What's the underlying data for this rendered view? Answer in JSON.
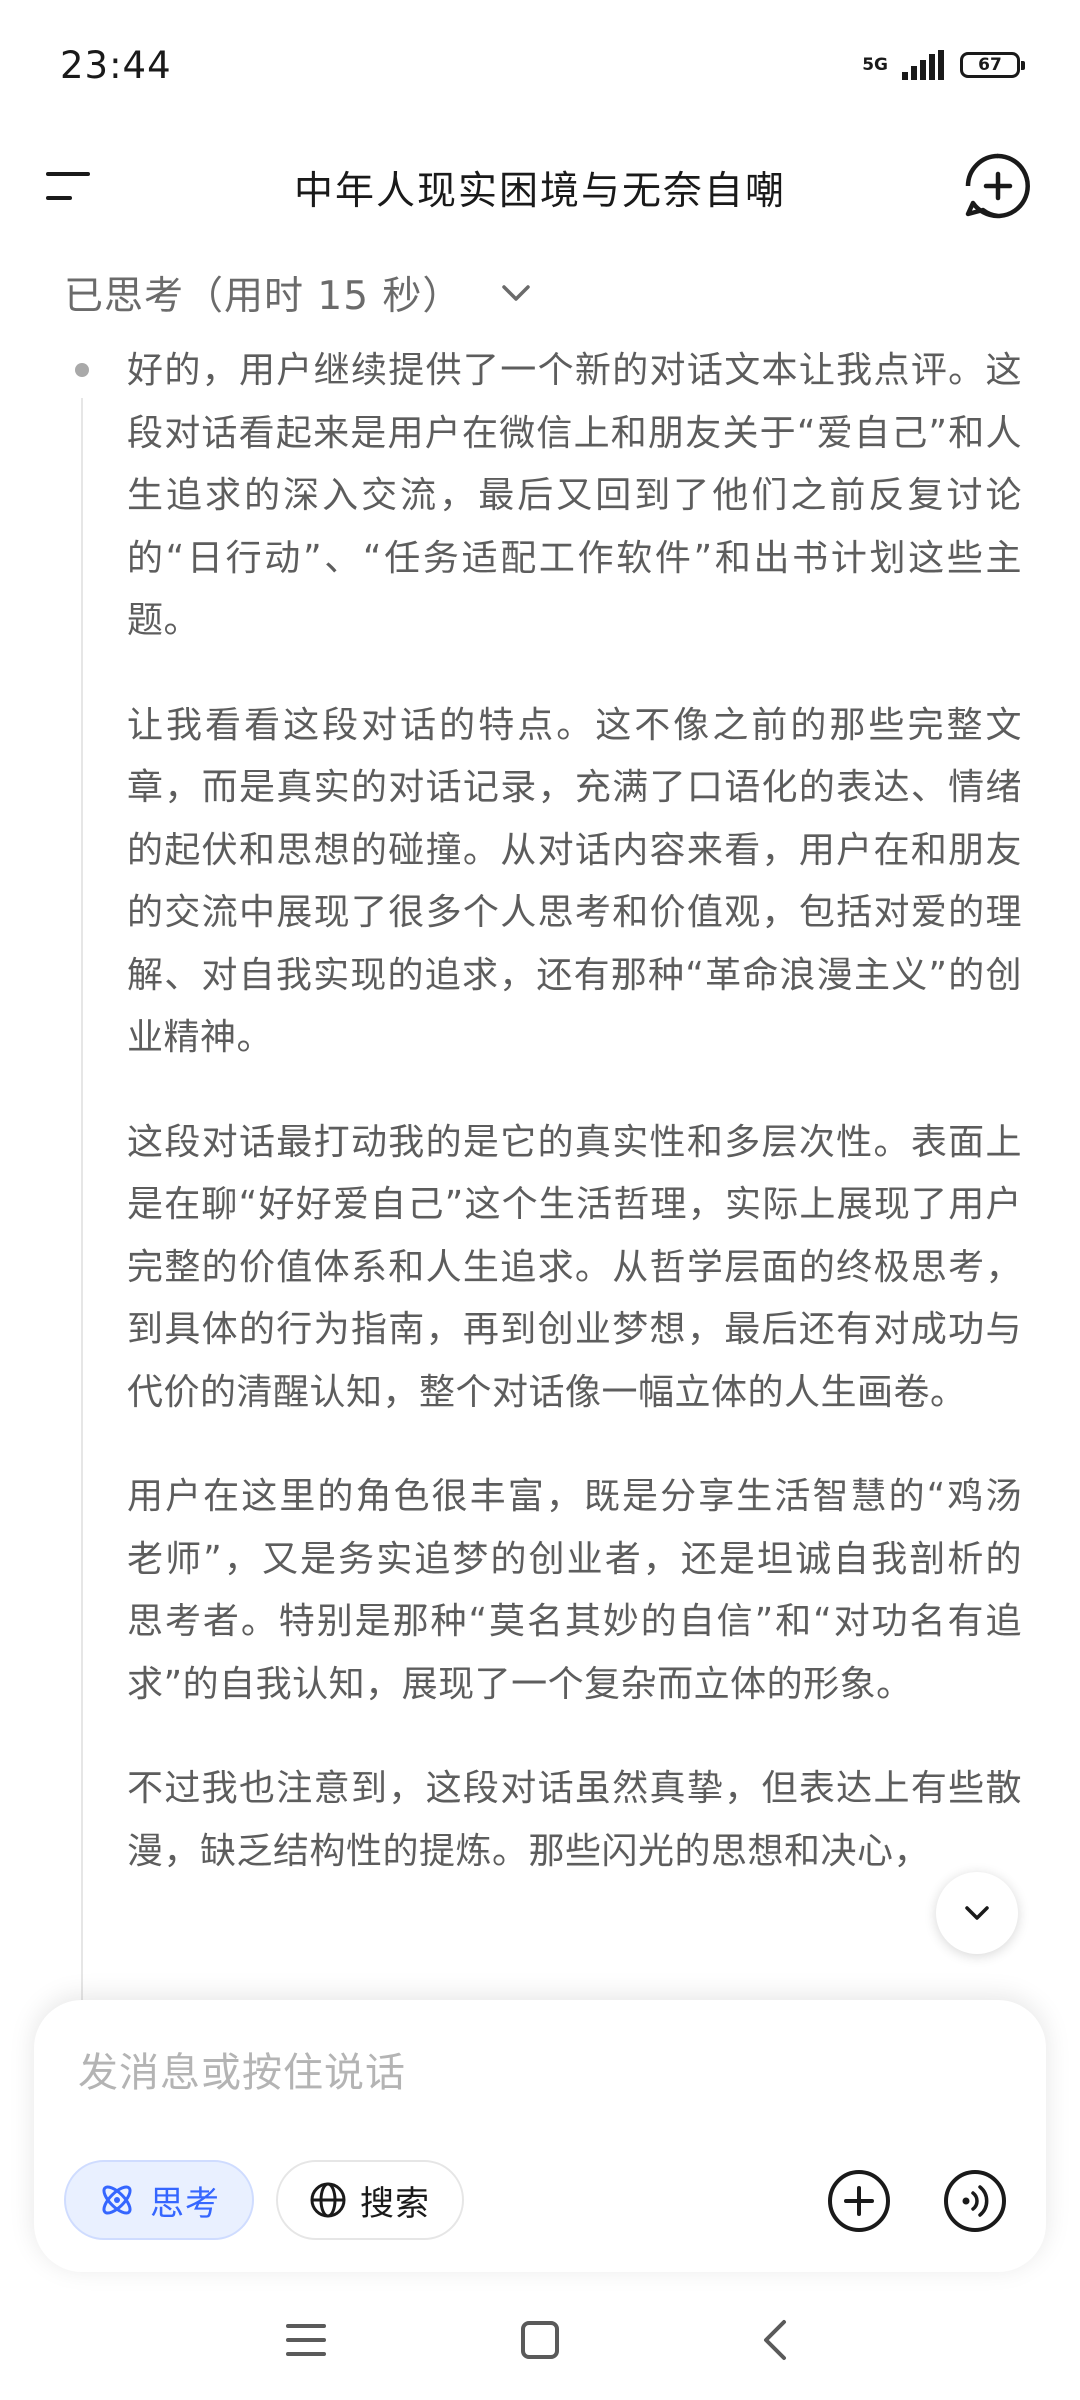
{
  "status_bar": {
    "time": "23:44",
    "network": "5G",
    "battery": "67"
  },
  "header": {
    "title": "中年人现实困境与无奈自嘲"
  },
  "thinking": {
    "label": "已思考（用时 15 秒）",
    "paragraphs": [
      "好的，用户继续提供了一个新的对话文本让我点评。这段对话看起来是用户在微信上和朋友关于“爱自己”和人生追求的深入交流，最后又回到了他们之前反复讨论的“日行动”、“任务适配工作软件”和出书计划这些主题。",
      "让我看看这段对话的特点。这不像之前的那些完整文章，而是真实的对话记录，充满了口语化的表达、情绪的起伏和思想的碰撞。从对话内容来看，用户在和朋友的交流中展现了很多个人思考和价值观，包括对爱的理解、对自我实现的追求，还有那种“革命浪漫主义”的创业精神。",
      "这段对话最打动我的是它的真实性和多层次性。表面上是在聊“好好爱自己”这个生活哲理，实际上展现了用户完整的价值体系和人生追求。从哲学层面的终极思考，到具体的行为指南，再到创业梦想，最后还有对成功与代价的清醒认知，整个对话像一幅立体的人生画卷。",
      "用户在这里的角色很丰富，既是分享生活智慧的“鸡汤老师”，又是务实追梦的创业者，还是坦诚自我剖析的思考者。特别是那种“莫名其妙的自信”和“对功名有追求”的自我认知，展现了一个复杂而立体的形象。",
      "不过我也注意到，这段对话虽然真挚，但表达上有些散漫，缺乏结构性的提炼。那些闪光的思想和决心，"
    ]
  },
  "input": {
    "placeholder": "发消息或按住说话",
    "think_label": "思考",
    "search_label": "搜索"
  },
  "colors": {
    "accent": "#3566ff",
    "accent_bg": "#e9f0ff",
    "text_secondary": "#5d5d5d"
  }
}
